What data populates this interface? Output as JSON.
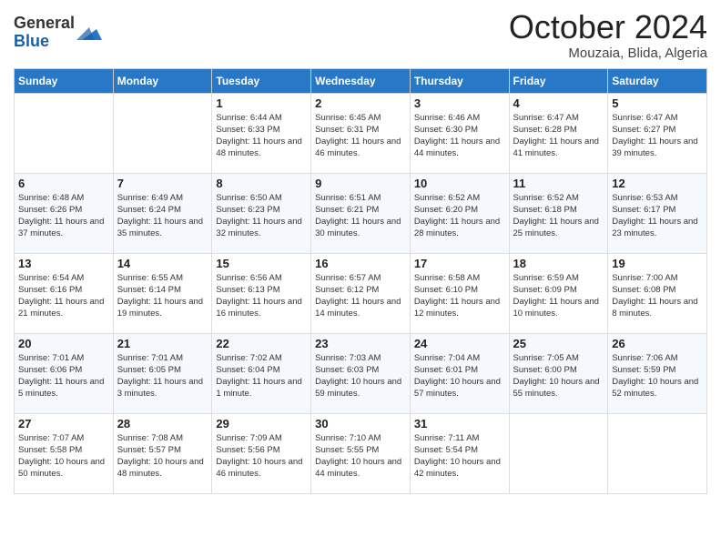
{
  "logo": {
    "general": "General",
    "blue": "Blue"
  },
  "header": {
    "month": "October 2024",
    "location": "Mouzaia, Blida, Algeria"
  },
  "days_of_week": [
    "Sunday",
    "Monday",
    "Tuesday",
    "Wednesday",
    "Thursday",
    "Friday",
    "Saturday"
  ],
  "weeks": [
    [
      {
        "day": "",
        "sunrise": "",
        "sunset": "",
        "daylight": ""
      },
      {
        "day": "",
        "sunrise": "",
        "sunset": "",
        "daylight": ""
      },
      {
        "day": "1",
        "sunrise": "Sunrise: 6:44 AM",
        "sunset": "Sunset: 6:33 PM",
        "daylight": "Daylight: 11 hours and 48 minutes."
      },
      {
        "day": "2",
        "sunrise": "Sunrise: 6:45 AM",
        "sunset": "Sunset: 6:31 PM",
        "daylight": "Daylight: 11 hours and 46 minutes."
      },
      {
        "day": "3",
        "sunrise": "Sunrise: 6:46 AM",
        "sunset": "Sunset: 6:30 PM",
        "daylight": "Daylight: 11 hours and 44 minutes."
      },
      {
        "day": "4",
        "sunrise": "Sunrise: 6:47 AM",
        "sunset": "Sunset: 6:28 PM",
        "daylight": "Daylight: 11 hours and 41 minutes."
      },
      {
        "day": "5",
        "sunrise": "Sunrise: 6:47 AM",
        "sunset": "Sunset: 6:27 PM",
        "daylight": "Daylight: 11 hours and 39 minutes."
      }
    ],
    [
      {
        "day": "6",
        "sunrise": "Sunrise: 6:48 AM",
        "sunset": "Sunset: 6:26 PM",
        "daylight": "Daylight: 11 hours and 37 minutes."
      },
      {
        "day": "7",
        "sunrise": "Sunrise: 6:49 AM",
        "sunset": "Sunset: 6:24 PM",
        "daylight": "Daylight: 11 hours and 35 minutes."
      },
      {
        "day": "8",
        "sunrise": "Sunrise: 6:50 AM",
        "sunset": "Sunset: 6:23 PM",
        "daylight": "Daylight: 11 hours and 32 minutes."
      },
      {
        "day": "9",
        "sunrise": "Sunrise: 6:51 AM",
        "sunset": "Sunset: 6:21 PM",
        "daylight": "Daylight: 11 hours and 30 minutes."
      },
      {
        "day": "10",
        "sunrise": "Sunrise: 6:52 AM",
        "sunset": "Sunset: 6:20 PM",
        "daylight": "Daylight: 11 hours and 28 minutes."
      },
      {
        "day": "11",
        "sunrise": "Sunrise: 6:52 AM",
        "sunset": "Sunset: 6:18 PM",
        "daylight": "Daylight: 11 hours and 25 minutes."
      },
      {
        "day": "12",
        "sunrise": "Sunrise: 6:53 AM",
        "sunset": "Sunset: 6:17 PM",
        "daylight": "Daylight: 11 hours and 23 minutes."
      }
    ],
    [
      {
        "day": "13",
        "sunrise": "Sunrise: 6:54 AM",
        "sunset": "Sunset: 6:16 PM",
        "daylight": "Daylight: 11 hours and 21 minutes."
      },
      {
        "day": "14",
        "sunrise": "Sunrise: 6:55 AM",
        "sunset": "Sunset: 6:14 PM",
        "daylight": "Daylight: 11 hours and 19 minutes."
      },
      {
        "day": "15",
        "sunrise": "Sunrise: 6:56 AM",
        "sunset": "Sunset: 6:13 PM",
        "daylight": "Daylight: 11 hours and 16 minutes."
      },
      {
        "day": "16",
        "sunrise": "Sunrise: 6:57 AM",
        "sunset": "Sunset: 6:12 PM",
        "daylight": "Daylight: 11 hours and 14 minutes."
      },
      {
        "day": "17",
        "sunrise": "Sunrise: 6:58 AM",
        "sunset": "Sunset: 6:10 PM",
        "daylight": "Daylight: 11 hours and 12 minutes."
      },
      {
        "day": "18",
        "sunrise": "Sunrise: 6:59 AM",
        "sunset": "Sunset: 6:09 PM",
        "daylight": "Daylight: 11 hours and 10 minutes."
      },
      {
        "day": "19",
        "sunrise": "Sunrise: 7:00 AM",
        "sunset": "Sunset: 6:08 PM",
        "daylight": "Daylight: 11 hours and 8 minutes."
      }
    ],
    [
      {
        "day": "20",
        "sunrise": "Sunrise: 7:01 AM",
        "sunset": "Sunset: 6:06 PM",
        "daylight": "Daylight: 11 hours and 5 minutes."
      },
      {
        "day": "21",
        "sunrise": "Sunrise: 7:01 AM",
        "sunset": "Sunset: 6:05 PM",
        "daylight": "Daylight: 11 hours and 3 minutes."
      },
      {
        "day": "22",
        "sunrise": "Sunrise: 7:02 AM",
        "sunset": "Sunset: 6:04 PM",
        "daylight": "Daylight: 11 hours and 1 minute."
      },
      {
        "day": "23",
        "sunrise": "Sunrise: 7:03 AM",
        "sunset": "Sunset: 6:03 PM",
        "daylight": "Daylight: 10 hours and 59 minutes."
      },
      {
        "day": "24",
        "sunrise": "Sunrise: 7:04 AM",
        "sunset": "Sunset: 6:01 PM",
        "daylight": "Daylight: 10 hours and 57 minutes."
      },
      {
        "day": "25",
        "sunrise": "Sunrise: 7:05 AM",
        "sunset": "Sunset: 6:00 PM",
        "daylight": "Daylight: 10 hours and 55 minutes."
      },
      {
        "day": "26",
        "sunrise": "Sunrise: 7:06 AM",
        "sunset": "Sunset: 5:59 PM",
        "daylight": "Daylight: 10 hours and 52 minutes."
      }
    ],
    [
      {
        "day": "27",
        "sunrise": "Sunrise: 7:07 AM",
        "sunset": "Sunset: 5:58 PM",
        "daylight": "Daylight: 10 hours and 50 minutes."
      },
      {
        "day": "28",
        "sunrise": "Sunrise: 7:08 AM",
        "sunset": "Sunset: 5:57 PM",
        "daylight": "Daylight: 10 hours and 48 minutes."
      },
      {
        "day": "29",
        "sunrise": "Sunrise: 7:09 AM",
        "sunset": "Sunset: 5:56 PM",
        "daylight": "Daylight: 10 hours and 46 minutes."
      },
      {
        "day": "30",
        "sunrise": "Sunrise: 7:10 AM",
        "sunset": "Sunset: 5:55 PM",
        "daylight": "Daylight: 10 hours and 44 minutes."
      },
      {
        "day": "31",
        "sunrise": "Sunrise: 7:11 AM",
        "sunset": "Sunset: 5:54 PM",
        "daylight": "Daylight: 10 hours and 42 minutes."
      },
      {
        "day": "",
        "sunrise": "",
        "sunset": "",
        "daylight": ""
      },
      {
        "day": "",
        "sunrise": "",
        "sunset": "",
        "daylight": ""
      }
    ]
  ]
}
